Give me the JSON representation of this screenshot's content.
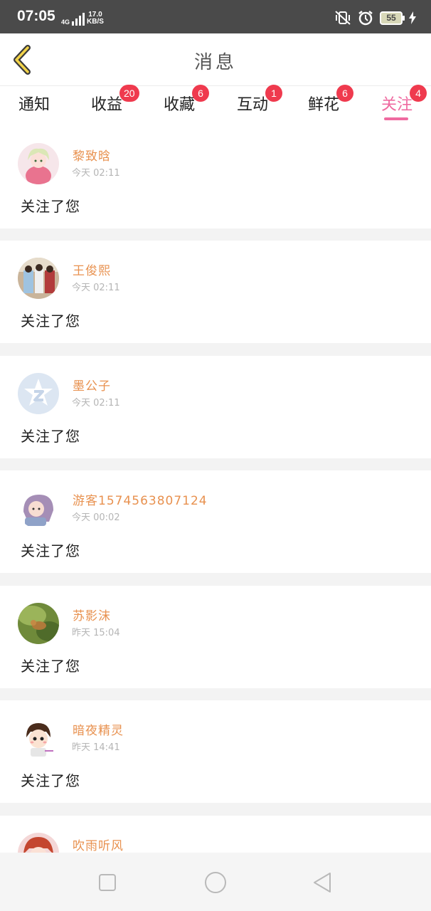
{
  "status_bar": {
    "time": "07:05",
    "network": "4G",
    "speed_value": "17.0",
    "speed_unit": "KB/S",
    "battery": "55",
    "icons": [
      "signal-icon",
      "mute-vibrate-icon",
      "alarm-icon",
      "battery-icon",
      "charging-icon"
    ]
  },
  "header": {
    "title": "消息",
    "back_icon": "chevron-left-icon"
  },
  "tabs": [
    {
      "label": "通知",
      "badge": ""
    },
    {
      "label": "收益",
      "badge": "20"
    },
    {
      "label": "收藏",
      "badge": "6"
    },
    {
      "label": "互动",
      "badge": "1"
    },
    {
      "label": "鲜花",
      "badge": "6"
    },
    {
      "label": "关注",
      "badge": "4",
      "active": true
    }
  ],
  "messages": [
    {
      "name": "黎致晗",
      "time": "今天 02:11",
      "text": "关注了您"
    },
    {
      "name": "王俊熙",
      "time": "今天 02:11",
      "text": "关注了您"
    },
    {
      "name": "墨公子",
      "time": "今天 02:11",
      "text": "关注了您"
    },
    {
      "name": "游客1574563807124",
      "time": "今天 00:02",
      "text": "关注了您"
    },
    {
      "name": "苏影沫",
      "time": "昨天 15:04",
      "text": "关注了您"
    },
    {
      "name": "暗夜精灵",
      "time": "昨天 14:41",
      "text": "关注了您"
    },
    {
      "name": "吹雨听风",
      "time": "",
      "text": ""
    }
  ],
  "navbar": {
    "icons": [
      "recent-apps-square-icon",
      "home-circle-icon",
      "back-triangle-icon"
    ]
  },
  "colors": {
    "accent": "#ef6aa0",
    "badge": "#ef3a4e",
    "username": "#e8914f",
    "status_bar": "#4a4a4a"
  }
}
